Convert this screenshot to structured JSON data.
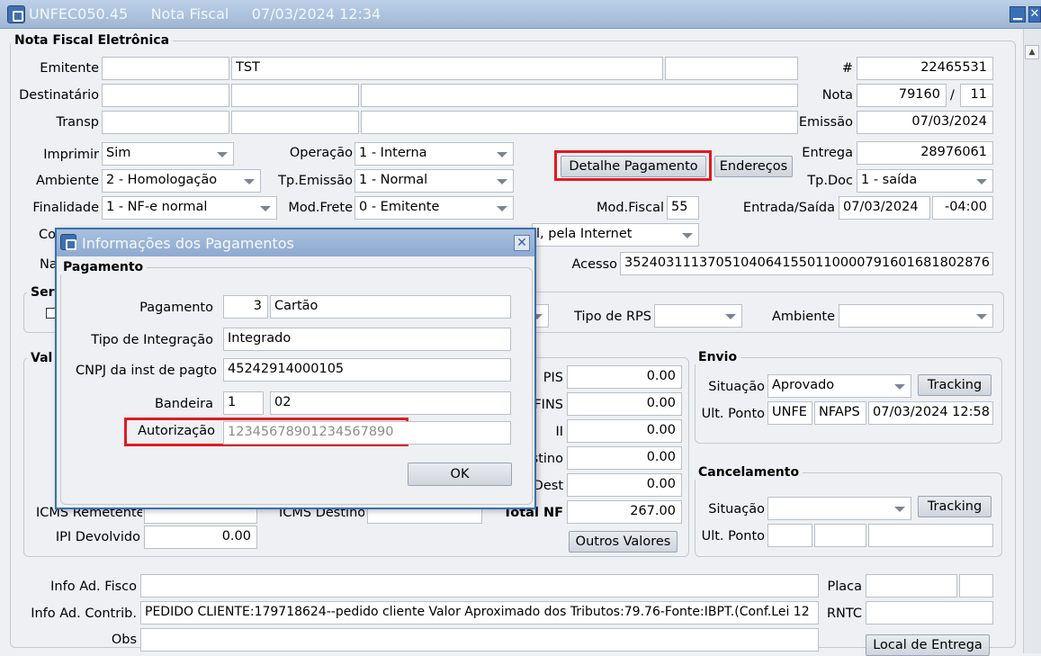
{
  "window": {
    "title": "UNFEC050.45     Nota Fiscal     07/03/2024 12:34",
    "minimize": "▁",
    "close": "✕"
  },
  "nfe": {
    "group_title": "Nota Fiscal Eletrônica",
    "emitente": {
      "label": "Emitente",
      "code": "",
      "name": "TST",
      "extra": ""
    },
    "destinatario": {
      "label": "Destinatário",
      "code": "",
      "doc": "",
      "name": ""
    },
    "transp": {
      "label": "Transp",
      "code": "",
      "doc": "",
      "name": ""
    },
    "numero": {
      "label": "#",
      "value": "22465531"
    },
    "nota": {
      "label": "Nota",
      "value": "79160",
      "sep": "/",
      "serie": "11"
    },
    "emissao": {
      "label": "Emissão",
      "value": "07/03/2024"
    },
    "entrega": {
      "label": "Entrega",
      "value": "28976061"
    },
    "tpdoc": {
      "label": "Tp.Doc",
      "value": "1 - saída"
    },
    "entrada_saida": {
      "label": "Entrada/Saída",
      "date": "07/03/2024",
      "tz": "-04:00"
    },
    "imprimir": {
      "label": "Imprimir",
      "value": "Sim"
    },
    "ambiente": {
      "label": "Ambiente",
      "value": "2 - Homologação"
    },
    "finalidade": {
      "label": "Finalidade",
      "value": "1 - NF-e normal"
    },
    "operacao": {
      "label": "Operação",
      "value": "1 - Interna"
    },
    "tp_emissao": {
      "label": "Tp.Emissão",
      "value": "1 - Normal"
    },
    "mod_frete": {
      "label": "Mod.Frete",
      "value": "0 - Emitente"
    },
    "mod_fiscal": {
      "label": "Mod.Fiscal",
      "value": "55"
    },
    "presenca": {
      "value": "l, pela Internet"
    },
    "acesso": {
      "label": "Acesso",
      "value": "35240311137051040641550110000791601681802876"
    },
    "btn_detalhe": "Detalhe Pagamento",
    "btn_enderecos": "Endereços",
    "label_co": "Co",
    "label_na": "Na"
  },
  "servico": {
    "label_partial": "Ser",
    "tipo_rps_label": "Tipo de RPS",
    "tipo_rps_value": "",
    "ambiente_label": "Ambiente",
    "ambiente_value": ""
  },
  "valores": {
    "label_partial": "Val",
    "pis": {
      "label": "PIS",
      "value": "0.00"
    },
    "cofins": {
      "label": "FINS",
      "value": "0.00"
    },
    "ii": {
      "label": "II",
      "value": "0.00"
    },
    "destino": {
      "label": "stino",
      "value": "0.00"
    },
    "dest": {
      "label": "Dest",
      "value": "0.00"
    },
    "total_nf": {
      "label": "Total NF",
      "value": "267.00"
    },
    "icms_remetente": {
      "label": "ICMS Remetente",
      "value": ""
    },
    "icms_destino": {
      "label": "ICMS Destino",
      "value": ""
    },
    "ipi_devolvido": {
      "label": "IPI Devolvido",
      "value": "0.00"
    },
    "btn_outros": "Outros Valores"
  },
  "envio": {
    "title": "Envio",
    "situacao_label": "Situação",
    "situacao_value": "Aprovado",
    "tracking": "Tracking",
    "ult_ponto_label": "Ult. Ponto",
    "p1": "UNFE",
    "p2": "NFAPS",
    "p3": "07/03/2024 12:58"
  },
  "cancelamento": {
    "title": "Cancelamento",
    "situacao_label": "Situação",
    "situacao_value": "",
    "tracking": "Tracking",
    "ult_ponto_label": "Ult. Ponto",
    "p1": "",
    "p2": "",
    "p3": ""
  },
  "info": {
    "fisco_label": "Info Ad. Fisco",
    "fisco_value": "",
    "contrib_label": "Info Ad. Contrib.",
    "contrib_value": "PEDIDO CLIENTE:179718624--pedido cliente Valor Aproximado dos Tributos:79.76-Fonte:IBPT.(Conf.Lei 12",
    "obs_label": "Obs",
    "obs_value": "",
    "placa_label": "Placa",
    "placa_value": "",
    "placa_uf": "",
    "rntc_label": "RNTC",
    "rntc_value": "",
    "btn_local": "Local de Entrega"
  },
  "dialog": {
    "title": "Informações dos Pagamentos",
    "close": "✕",
    "group_title": "Pagamento",
    "pagamento_label": "Pagamento",
    "pagamento_code": "3",
    "pagamento_desc": "Cartão",
    "tipo_integracao_label": "Tipo de Integração",
    "tipo_integracao_value": "Integrado",
    "cnpj_label": "CNPJ da inst de pagto",
    "cnpj_value": "45242914000105",
    "bandeira_label": "Bandeira",
    "bandeira_code": "1",
    "bandeira_value": "02",
    "autorizacao_label": "Autorização",
    "autorizacao_value": "12345678901234567890",
    "ok": "OK"
  }
}
